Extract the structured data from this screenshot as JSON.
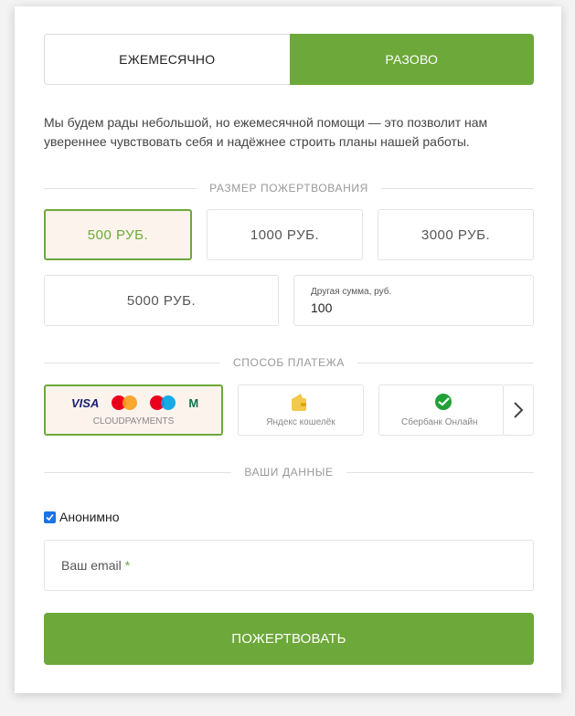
{
  "frequency": {
    "monthly_label": "ЕЖЕМЕСЯЧНО",
    "once_label": "РАЗОВО",
    "selected": "once"
  },
  "intro_text": "Мы будем рады небольшой, но ежемесячной помощи — это позволит нам увереннее чувствовать себя и надёжнее строить планы нашей работы.",
  "amount_section": {
    "title": "РАЗМЕР ПОЖЕРТВОВАНИЯ",
    "options": [
      "500 РУБ.",
      "1000 РУБ.",
      "3000 РУБ.",
      "5000 РУБ."
    ],
    "selected_index": 0,
    "other": {
      "label": "Другая сумма, руб.",
      "value": "100"
    }
  },
  "payment_section": {
    "title": "СПОСОБ ПЛАТЕЖА",
    "methods": [
      {
        "name": "CLOUDPAYMENTS",
        "logos": [
          "VISA",
          "mastercard",
          "maestro",
          "M"
        ]
      },
      {
        "name": "Яндекс кошелёк",
        "icon": "yandex-wallet-icon"
      },
      {
        "name": "Сбербанк Онлайн",
        "icon": "sberbank-icon"
      }
    ],
    "selected_index": 0
  },
  "details_section": {
    "title": "ВАШИ ДАННЫЕ",
    "anonymous_label": "Анонимно",
    "anonymous_checked": true,
    "email_placeholder": "Ваш email",
    "required_mark": "*"
  },
  "submit_label": "ПОЖЕРТВОВАТЬ",
  "colors": {
    "accent": "#6da83a",
    "selected_bg": "#fcf3ec",
    "checkbox": "#1a73e8"
  }
}
